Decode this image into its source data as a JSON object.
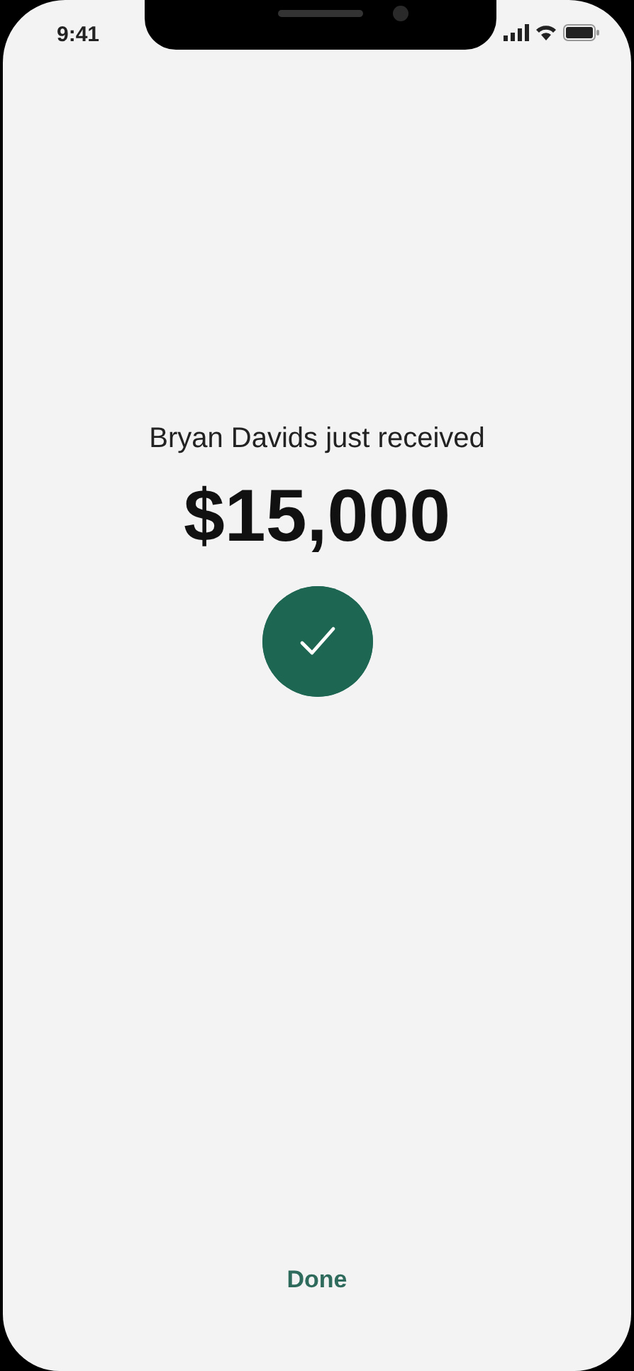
{
  "status_bar": {
    "time": "9:41"
  },
  "message": "Bryan Davids just received",
  "amount": "$15,000",
  "done_button": "Done"
}
